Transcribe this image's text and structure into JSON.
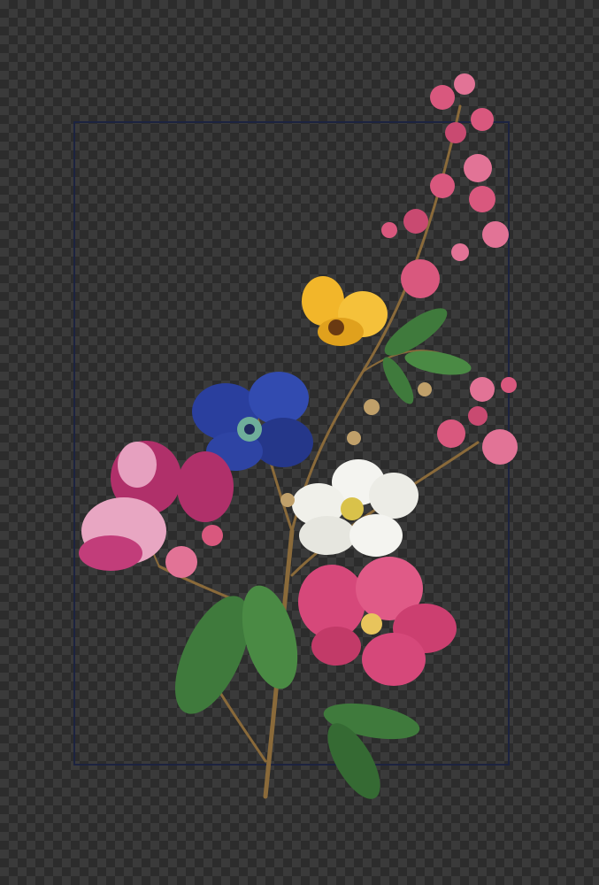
{
  "colors": {
    "checker_light": "#3a3a3a",
    "checker_dark": "#2c2c2c",
    "frame": "#1c2340",
    "pink_blossom": "#d9587e",
    "yellow_flower": "#f2b62a",
    "blue_anemone": "#2a3f9e",
    "white_rose": "#f4f4f0",
    "magenta_lily": "#d6487a",
    "magnolia": "#b0306a",
    "leaf": "#3f7a3c",
    "stem": "#8a6a3a"
  },
  "elements": [
    "transparency-checkerboard",
    "rectangle-frame",
    "flower-bouquet-illustration"
  ]
}
